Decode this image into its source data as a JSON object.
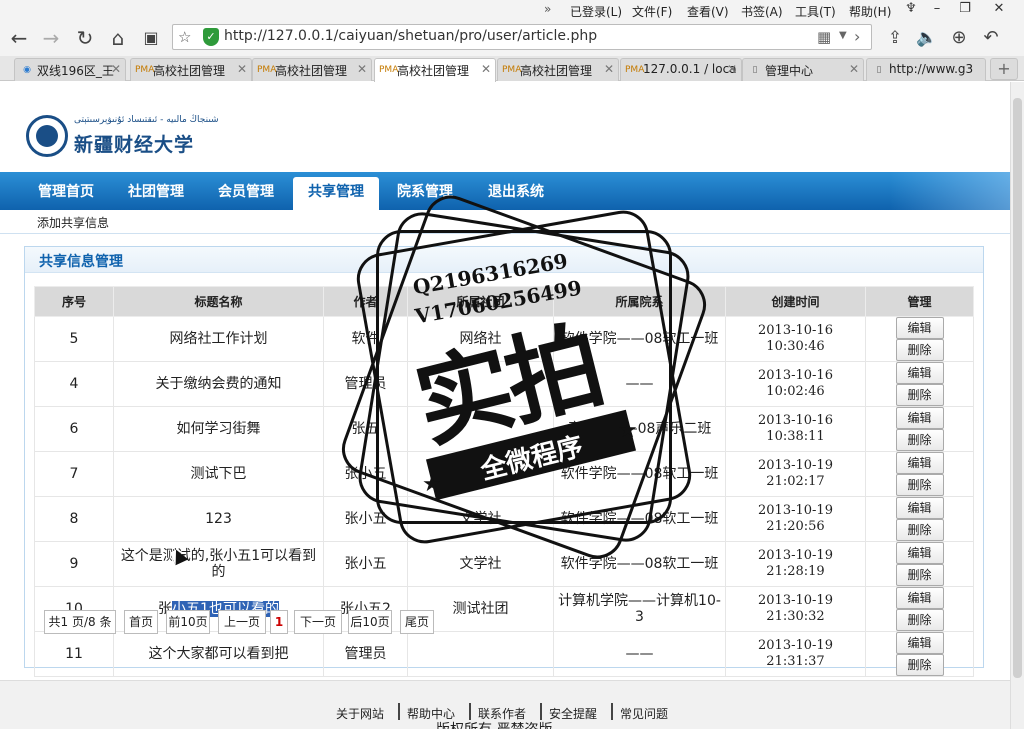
{
  "browser": {
    "menu_items": [
      "已登录(L)",
      "文件(F)",
      "查看(V)",
      "书签(A)",
      "工具(T)",
      "帮助(H)"
    ],
    "url": "http://127.0.0.1/caiyuan/shetuan/pro/user/article.php",
    "tabs": [
      {
        "label": "双线196区_王",
        "icon": "globe-icon"
      },
      {
        "label": "高校社团管理",
        "icon": "pma-icon"
      },
      {
        "label": "高校社团管理",
        "icon": "pma-icon"
      },
      {
        "label": "高校社团管理",
        "icon": "pma-icon"
      },
      {
        "label": "高校社团管理",
        "icon": "pma-icon"
      },
      {
        "label": "127.0.0.1 / loca",
        "icon": "pma-icon"
      },
      {
        "label": "管理中心",
        "icon": "page-icon"
      },
      {
        "label": "http://www.g3",
        "icon": "page-icon"
      }
    ]
  },
  "site": {
    "logo_uyghur": "شىنجاڭ مالىيە - ئىقتىساد ئۇنىۋېرسىتېتى",
    "logo_name": "新疆财经大学",
    "nav": [
      "管理首页",
      "社团管理",
      "会员管理",
      "共享管理",
      "院系管理",
      "退出系统"
    ],
    "nav_active": "共享管理",
    "subnav": "添加共享信息",
    "panel_title": "共享信息管理"
  },
  "table": {
    "headers": [
      "序号",
      "标题名称",
      "作者",
      "所属社团",
      "所属院系",
      "创建时间",
      "管理"
    ],
    "edit_label": "编辑",
    "delete_label": "删除",
    "rows": [
      {
        "id": "5",
        "title": "网络社工作计划",
        "author": "软件",
        "club": "网络社",
        "dept": "软件学院——08软工一班",
        "time": "2013-10-16 10:30:46"
      },
      {
        "id": "4",
        "title": "关于缴纳会费的通知",
        "author": "管理员",
        "club": "",
        "dept": "——",
        "time": "2013-10-16 10:02:46"
      },
      {
        "id": "6",
        "title": "如何学习街舞",
        "author": "张五",
        "club": "",
        "dept": "音乐系——08声乐二班",
        "time": "2013-10-16 10:38:11"
      },
      {
        "id": "7",
        "title": "测试下巴",
        "author": "张小五",
        "club": "文学社",
        "dept": "软件学院——08软工一班",
        "time": "2013-10-19 21:02:17"
      },
      {
        "id": "8",
        "title": "123",
        "author": "张小五",
        "club": "文学社",
        "dept": "软件学院——08软工一班",
        "time": "2013-10-19 21:20:56"
      },
      {
        "id": "9",
        "title": "这个是测试的,张小五1可以看到的",
        "author": "张小五",
        "club": "文学社",
        "dept": "软件学院——08软工一班",
        "time": "2013-10-19 21:28:19"
      },
      {
        "id": "10",
        "title_plain": "张",
        "title_selected": "小五1也可以看的",
        "author": "张小五2",
        "club": "测试社团",
        "dept": "计算机学院——计算机10-3",
        "time": "2013-10-19 21:30:32"
      },
      {
        "id": "11",
        "title": "这个大家都可以看到把",
        "author": "管理员",
        "club": "",
        "dept": "——",
        "time": "2013-10-19 21:31:37"
      }
    ]
  },
  "pager": {
    "summary": "共1 页/8 条",
    "first": "首页",
    "prev10": "前10页",
    "prev": "上一页",
    "current": "1",
    "next": "下一页",
    "next10": "后10页",
    "last": "尾页"
  },
  "footer": {
    "links": [
      "关于网站",
      "帮助中心",
      "联系作者",
      "安全提醒",
      "常见问题"
    ],
    "copyright": "版权所有 严禁盗版"
  },
  "watermark": {
    "qq": "Q2196316269",
    "wechat": "V17060256499",
    "big": "实拍",
    "banner": "全微程序"
  },
  "colors": {
    "nav_blue": "#0f62ad",
    "selection": "#2f63b5",
    "secure_green": "#2e9a3a"
  }
}
